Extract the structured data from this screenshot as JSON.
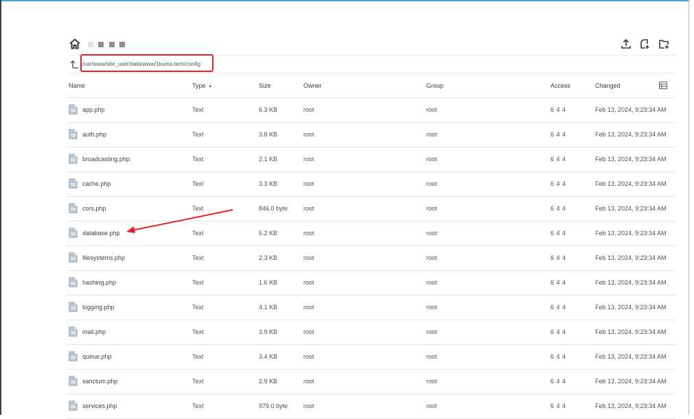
{
  "path": "/var/www/site_user/data/www/1kuma.tech/config",
  "columns": {
    "name": "Name",
    "type": "Type",
    "size": "Size",
    "owner": "Owner",
    "group": "Group",
    "access": "Access",
    "changed": "Changed"
  },
  "sort": {
    "column": "type",
    "direction": "ascending"
  },
  "icons": {
    "home": "home-icon",
    "upload": "upload-icon",
    "new_file": "new-file-icon",
    "new_folder": "new-folder-icon",
    "up": "up-directory-icon",
    "columns": "table-columns-icon",
    "file": "file-icon"
  },
  "colors": {
    "highlight": "#e8202a",
    "accent": "#4aa3df",
    "file_icon": "#b7c3cf"
  },
  "files": [
    {
      "name": "app.php",
      "type": "Text",
      "size": "6.3 KB",
      "owner": "root",
      "group": "root",
      "access": "6 4 4",
      "changed": "Feb 13, 2024, 9:23:34 AM"
    },
    {
      "name": "auth.php",
      "type": "Text",
      "size": "3.8 KB",
      "owner": "root",
      "group": "root",
      "access": "6 4 4",
      "changed": "Feb 13, 2024, 9:23:34 AM"
    },
    {
      "name": "broadcasting.php",
      "type": "Text",
      "size": "2.1 KB",
      "owner": "root",
      "group": "root",
      "access": "6 4 4",
      "changed": "Feb 13, 2024, 9:23:34 AM"
    },
    {
      "name": "cache.php",
      "type": "Text",
      "size": "3.3 KB",
      "owner": "root",
      "group": "root",
      "access": "6 4 4",
      "changed": "Feb 13, 2024, 9:23:34 AM"
    },
    {
      "name": "cors.php",
      "type": "Text",
      "size": "846.0 byte",
      "owner": "root",
      "group": "root",
      "access": "6 4 4",
      "changed": "Feb 13, 2024, 9:23:34 AM"
    },
    {
      "name": "database.php",
      "type": "Text",
      "size": "5.2 KB",
      "owner": "root",
      "group": "root",
      "access": "6 4 4",
      "changed": "Feb 13, 2024, 9:23:34 AM"
    },
    {
      "name": "filesystems.php",
      "type": "Text",
      "size": "2.3 KB",
      "owner": "root",
      "group": "root",
      "access": "6 4 4",
      "changed": "Feb 13, 2024, 9:23:34 AM"
    },
    {
      "name": "hashing.php",
      "type": "Text",
      "size": "1.6 KB",
      "owner": "root",
      "group": "root",
      "access": "6 4 4",
      "changed": "Feb 13, 2024, 9:23:34 AM"
    },
    {
      "name": "logging.php",
      "type": "Text",
      "size": "4.1 KB",
      "owner": "root",
      "group": "root",
      "access": "6 4 4",
      "changed": "Feb 13, 2024, 9:23:34 AM"
    },
    {
      "name": "mail.php",
      "type": "Text",
      "size": "3.9 KB",
      "owner": "root",
      "group": "root",
      "access": "6 4 4",
      "changed": "Feb 13, 2024, 9:23:34 AM"
    },
    {
      "name": "queue.php",
      "type": "Text",
      "size": "3.4 KB",
      "owner": "root",
      "group": "root",
      "access": "6 4 4",
      "changed": "Feb 13, 2024, 9:23:34 AM"
    },
    {
      "name": "sanctum.php",
      "type": "Text",
      "size": "2.9 KB",
      "owner": "root",
      "group": "root",
      "access": "6 4 4",
      "changed": "Feb 13, 2024, 9:23:34 AM"
    },
    {
      "name": "services.php",
      "type": "Text",
      "size": "979.0 byte",
      "owner": "root",
      "group": "root",
      "access": "6 4 4",
      "changed": "Feb 13, 2024, 9:23:34 AM"
    }
  ]
}
